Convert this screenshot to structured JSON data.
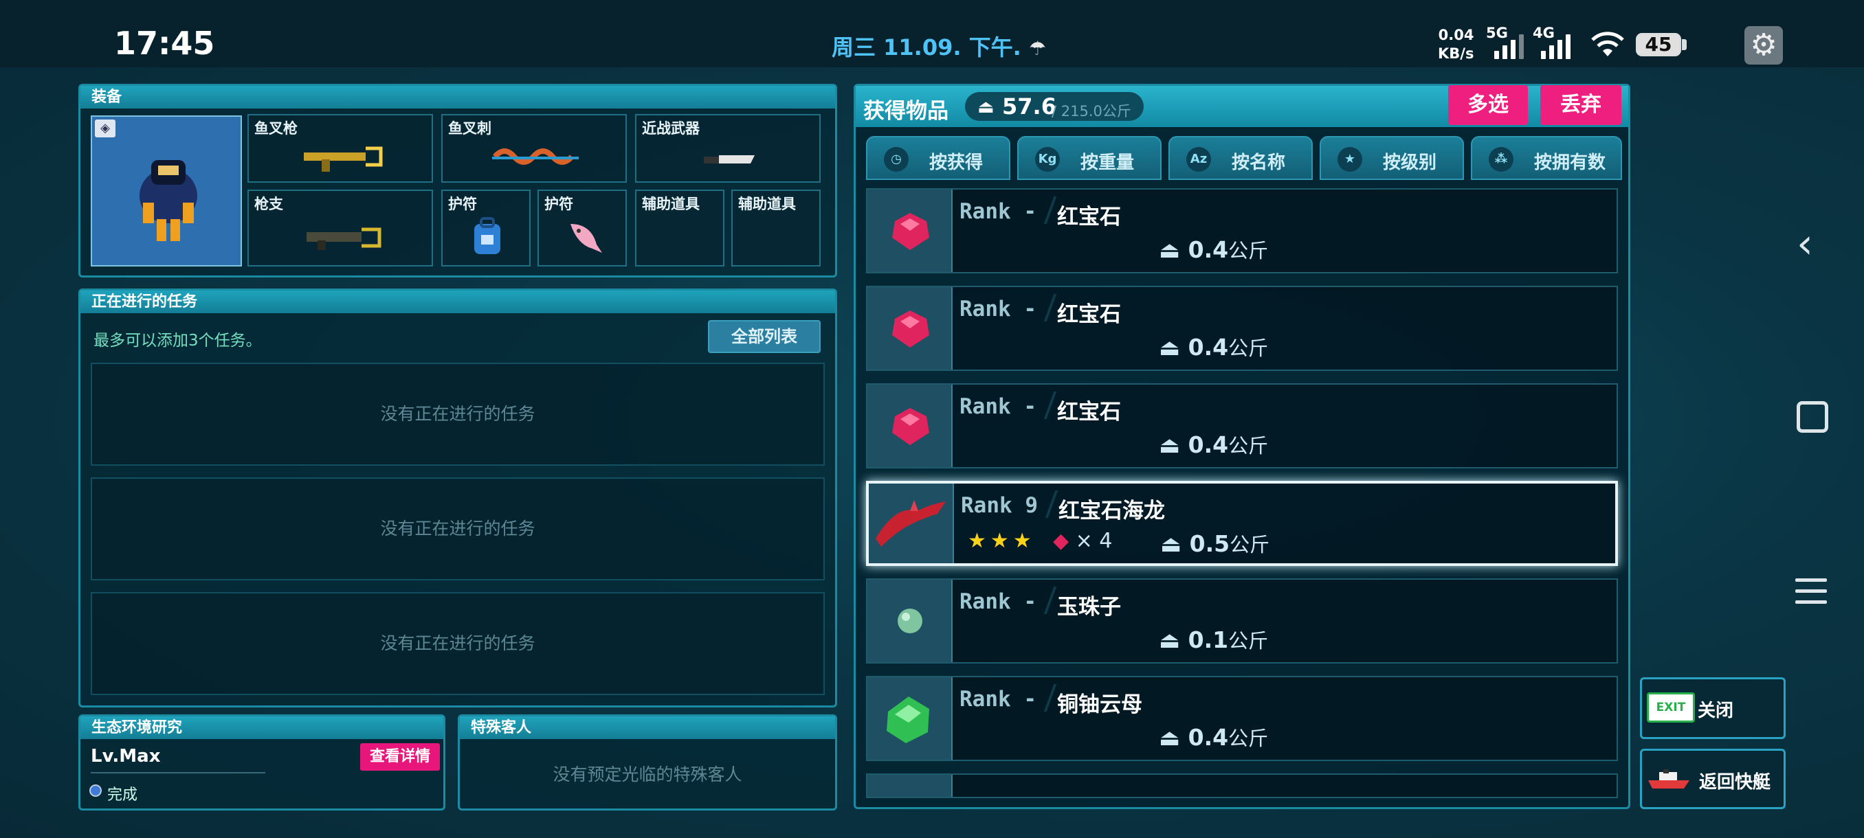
{
  "status": {
    "time": "17:45",
    "date": "周三 11.09. 下午.",
    "net_speed_value": "0.04",
    "net_speed_unit": "KB/s",
    "net1": "5G",
    "net2": "4G",
    "battery": "45"
  },
  "equipment": {
    "title": "装备",
    "slots": {
      "harpoon_gun": "鱼叉枪",
      "harpoon": "鱼叉刺",
      "melee": "近战武器",
      "gun": "枪支",
      "charm1": "护符",
      "charm2": "护符",
      "aux1": "辅助道具",
      "aux2": "辅助道具"
    }
  },
  "tasks": {
    "title": "正在进行的任务",
    "hint": "最多可以添加3个任务。",
    "all_list": "全部列表",
    "empty": [
      "没有正在进行的任务",
      "没有正在进行的任务",
      "没有正在进行的任务"
    ]
  },
  "eco": {
    "title": "生态环境研究",
    "level": "Lv.Max",
    "detail": "查看详情",
    "status": "完成"
  },
  "guest": {
    "title": "特殊客人",
    "empty": "没有预定光临的特殊客人"
  },
  "items": {
    "title": "获得物品",
    "weight_current": "57.6",
    "weight_max": "/ 215.0公斤",
    "multi_select": "多选",
    "discard": "丢弃",
    "tabs": [
      "按获得",
      "按重量",
      "按名称",
      "按级别",
      "按拥有数"
    ],
    "tab_icons": [
      "clock-icon",
      "kg-icon",
      "az-icon",
      "star-icon",
      "dots-icon"
    ],
    "tab_icon_text": [
      "",
      "Kg",
      "Az",
      "★",
      "⁂"
    ],
    "rows": [
      {
        "rank": "Rank -",
        "name": "红宝石",
        "weight": "0.4",
        "unit": "公斤",
        "icon": "ruby-icon"
      },
      {
        "rank": "Rank -",
        "name": "红宝石",
        "weight": "0.4",
        "unit": "公斤",
        "icon": "ruby-icon"
      },
      {
        "rank": "Rank -",
        "name": "红宝石",
        "weight": "0.4",
        "unit": "公斤",
        "icon": "ruby-icon"
      },
      {
        "rank": "Rank 9",
        "name": "红宝石海龙",
        "weight": "0.5",
        "unit": "公斤",
        "icon": "seadragon-icon",
        "stars": "★★★",
        "mult": "× 4"
      },
      {
        "rank": "Rank -",
        "name": "玉珠子",
        "weight": "0.1",
        "unit": "公斤",
        "icon": "pearl-icon"
      },
      {
        "rank": "Rank -",
        "name": "铜铀云母",
        "weight": "0.4",
        "unit": "公斤",
        "icon": "mica-icon"
      }
    ]
  },
  "side": {
    "close_tag": "EXIT",
    "close": "关闭",
    "return": "返回快艇"
  },
  "colors": {
    "accent": "#ef1f7f",
    "panel_header": "#1fa3bd",
    "ruby": "#e0245e"
  }
}
